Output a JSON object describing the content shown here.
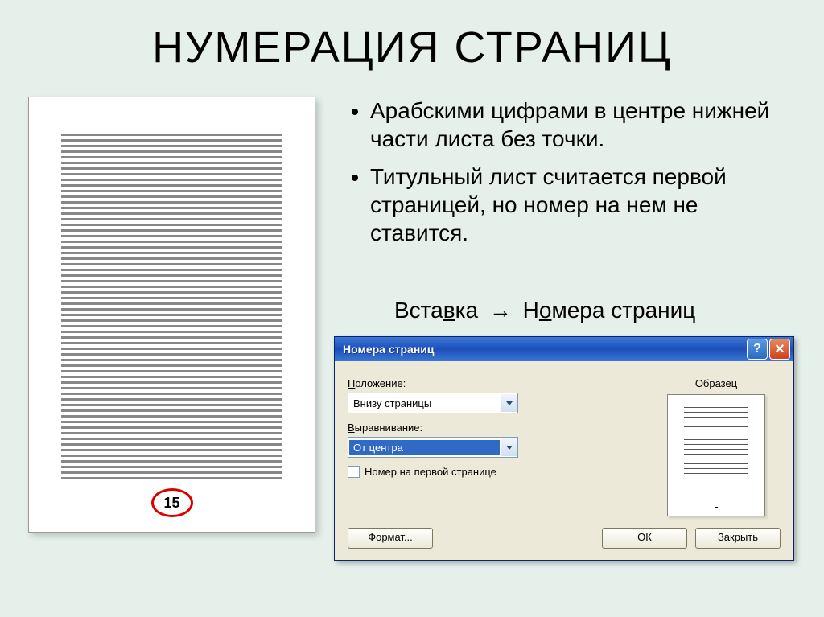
{
  "title": "НУМЕРАЦИЯ СТРАНИЦ",
  "page_number_example": "15",
  "bullets": [
    "Арабскими цифрами в центре нижней части листа без точки.",
    "Титульный лист считается первой страницей, но номер на нем не ставится."
  ],
  "menu_hint": {
    "p1_pre": "Вста",
    "p1_ul": "в",
    "p1_post": "ка",
    "arrow": "→",
    "p2_pre": "Н",
    "p2_ul": "о",
    "p2_post": "мера страниц"
  },
  "dialog": {
    "title": "Номера страниц",
    "position_label_pre": "",
    "position_label_ul": "П",
    "position_label_post": "оложение:",
    "position_value": "Внизу страницы",
    "align_label_pre": "",
    "align_label_ul": "В",
    "align_label_post": "ыравнивание:",
    "align_value": "От центра",
    "first_page_pre": "",
    "first_page_ul": "Н",
    "first_page_post": "омер на первой странице",
    "sample_label": "Образец",
    "format_btn_pre": "Фор",
    "format_btn_ul": "м",
    "format_btn_post": "ат...",
    "ok_btn": "ОК",
    "close_btn": "Закрыть"
  }
}
